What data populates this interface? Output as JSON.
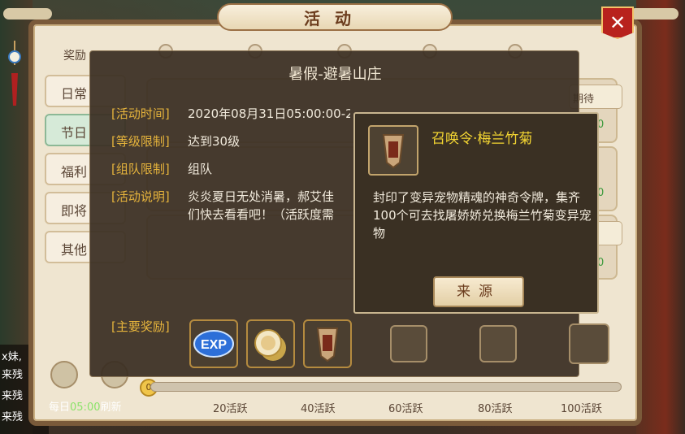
{
  "window": {
    "title": "活动",
    "close_icon": "close-icon"
  },
  "left_tabs": {
    "reward_label": "奖励",
    "items": [
      {
        "label": "日常"
      },
      {
        "label": "节日"
      },
      {
        "label": "福利"
      },
      {
        "label": "即将"
      },
      {
        "label": "其他"
      }
    ]
  },
  "ghost_list": {
    "right_buttons": [
      "期待",
      "待"
    ],
    "counts": [
      "0",
      "0",
      "0"
    ]
  },
  "bottom": {
    "daily_prefix": "每日",
    "daily_time": "05:00",
    "daily_suffix": "刷新",
    "coin_value": "0",
    "milestones": [
      "20活跃",
      "40活跃",
      "60活跃",
      "80活跃",
      "100活跃"
    ]
  },
  "left_chat": [
    "x妹,",
    "来残",
    "来残",
    "来残"
  ],
  "popup": {
    "title": "暑假-避暑山庄",
    "rows": [
      {
        "label": "[活动时间]",
        "value": "2020年08月31日05:00:00-2020年09月07日04:59:59"
      },
      {
        "label": "[等级限制]",
        "value": "达到30级"
      },
      {
        "label": "[组队限制]",
        "value": "组队"
      },
      {
        "label": "[活动说明]",
        "value": "炎炎夏日无处消暑，郝艾佳",
        "value2": "们快去看看吧！（活跃度需"
      }
    ],
    "rewards_label": "[主要奖励]",
    "rewards": [
      {
        "name": "exp-icon",
        "text": "EXP"
      },
      {
        "name": "pet-coin-icon",
        "text": ""
      },
      {
        "name": "summon-token-icon",
        "text": ""
      }
    ]
  },
  "tooltip": {
    "name": "召唤令·梅兰竹菊",
    "description": "封印了变异宠物精魂的神奇令牌，集齐100个可去找屠娇娇兑换梅兰竹菊变异宠物",
    "button": "来源"
  },
  "colors": {
    "label": "#e6b43c",
    "item_name": "#f4d632",
    "accent_green": "#8be36a"
  }
}
